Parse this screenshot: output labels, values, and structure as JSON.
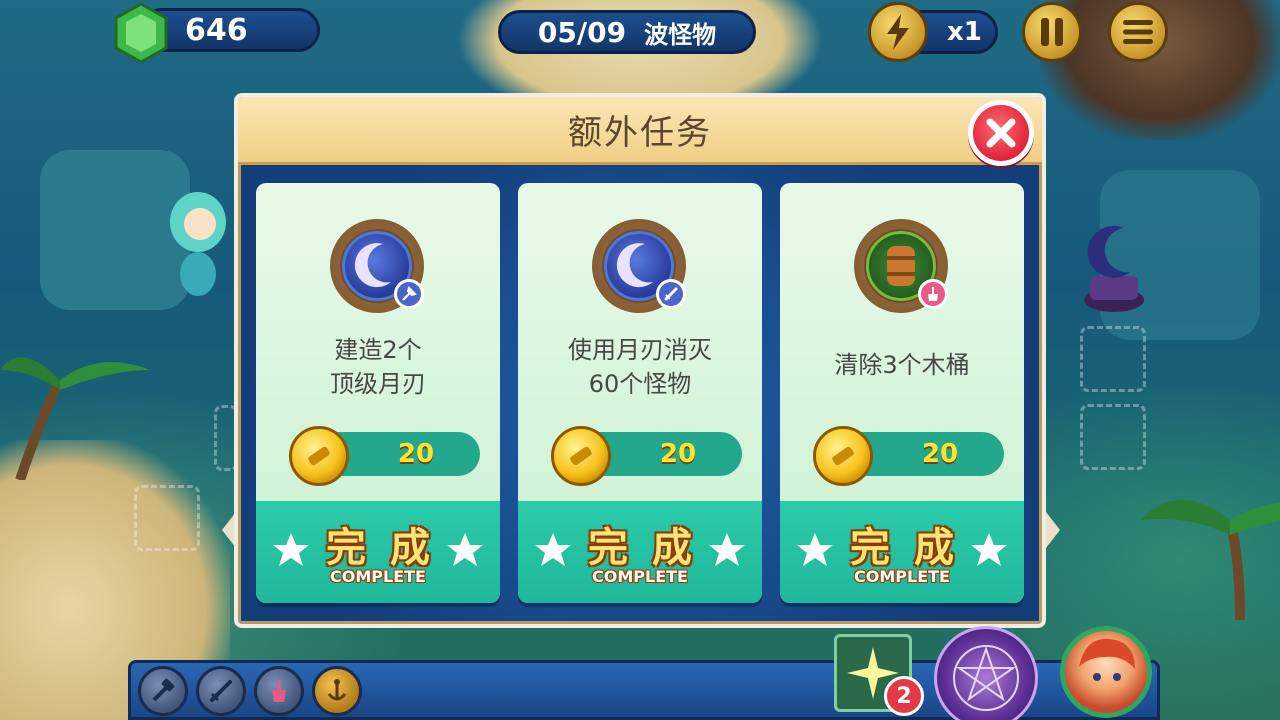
{
  "hud": {
    "gems": "646",
    "wave": "05/09",
    "wave_label": "波怪物",
    "speed": "x1"
  },
  "dialog": {
    "title": "额外任务",
    "tasks": [
      {
        "desc": "建造2个\n顶级月刃",
        "reward": "20",
        "complete_cn": "完成",
        "complete_en": "COMPLETE",
        "icon": "moon-blade-tower-icon",
        "badge": "upgrade-hammer-icon"
      },
      {
        "desc": "使用月刃消灭\n60个怪物",
        "reward": "20",
        "complete_cn": "完成",
        "complete_en": "COMPLETE",
        "icon": "moon-blade-tower-icon",
        "badge": "sword-icon"
      },
      {
        "desc": "清除3个木桶",
        "reward": "20",
        "complete_cn": "完成",
        "complete_en": "COMPLETE",
        "icon": "barrel-icon",
        "badge": "broom-icon"
      }
    ]
  },
  "skills": {
    "star_count": "2"
  },
  "colors": {
    "complete_area": "#1fb89a",
    "reward_text": "#ffe330",
    "close_button": "#e0243a"
  }
}
